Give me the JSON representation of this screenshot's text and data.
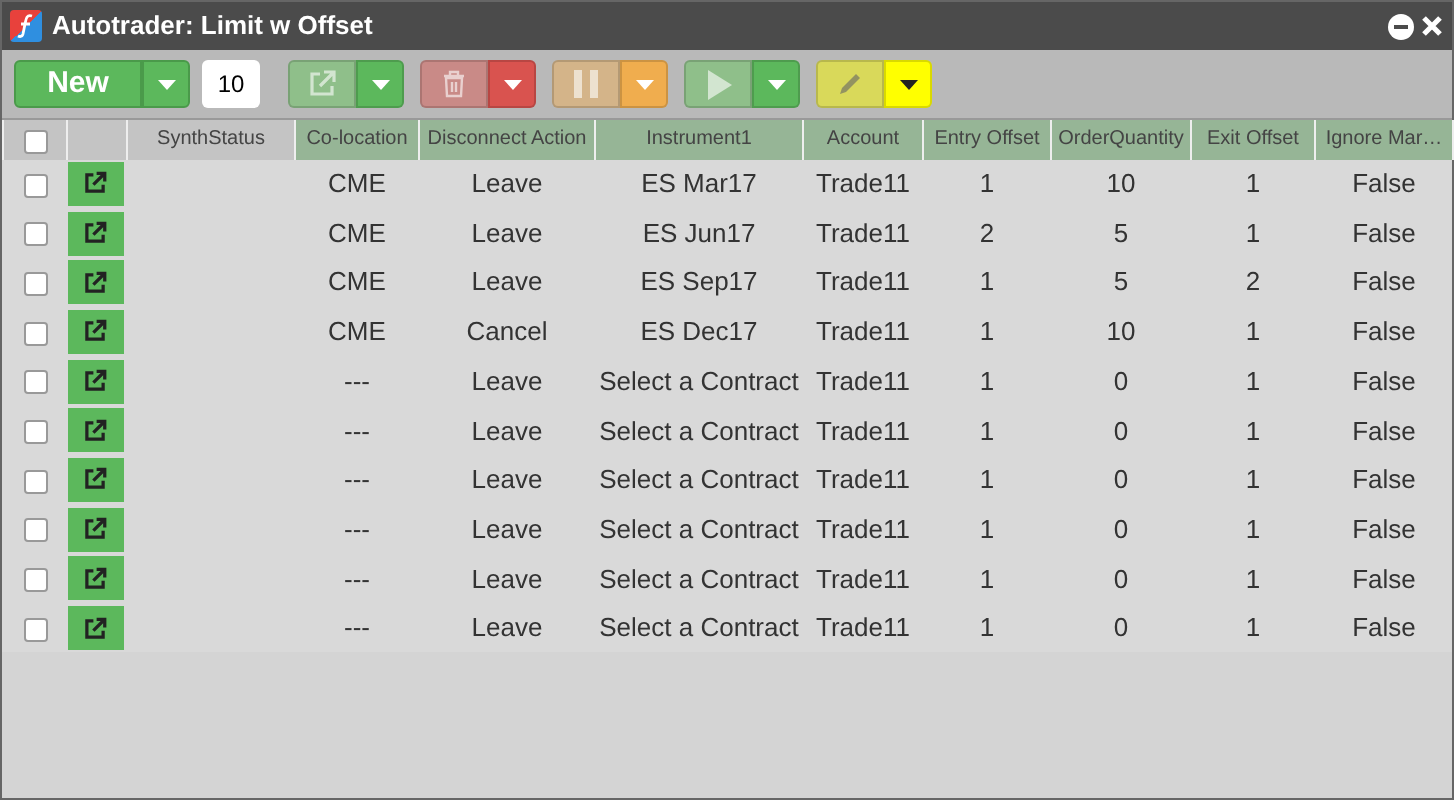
{
  "window": {
    "title": "Autotrader: Limit w Offset"
  },
  "toolbar": {
    "new_button": {
      "label": "New"
    },
    "quantity": "10",
    "tools": [
      {
        "kind": "launch",
        "disabled": true
      },
      {
        "kind": "delete",
        "disabled": true
      },
      {
        "kind": "pause",
        "disabled": true
      },
      {
        "kind": "play",
        "disabled": true
      },
      {
        "kind": "edit",
        "disabled": true
      }
    ]
  },
  "table": {
    "columns": [
      {
        "label": "SynthStatus",
        "highlighted": false
      },
      {
        "label": "Co-location",
        "highlighted": true
      },
      {
        "label": "Disconnect Action",
        "highlighted": true
      },
      {
        "label": "Instrument1",
        "highlighted": true
      },
      {
        "label": "Account",
        "highlighted": true
      },
      {
        "label": "Entry Offset",
        "highlighted": true
      },
      {
        "label": "OrderQuantity",
        "highlighted": true
      },
      {
        "label": "Exit Offset",
        "highlighted": true
      },
      {
        "label": "Ignore Mar…",
        "highlighted": true
      }
    ],
    "all_checked": false,
    "rows": [
      {
        "checked": false,
        "cells": [
          "",
          "CME",
          "Leave",
          "ES Mar17",
          "Trade11",
          "1",
          "10",
          "1",
          "False"
        ]
      },
      {
        "checked": false,
        "cells": [
          "",
          "CME",
          "Leave",
          "ES Jun17",
          "Trade11",
          "2",
          "5",
          "1",
          "False"
        ]
      },
      {
        "checked": false,
        "cells": [
          "",
          "CME",
          "Leave",
          "ES Sep17",
          "Trade11",
          "1",
          "5",
          "2",
          "False"
        ]
      },
      {
        "checked": false,
        "cells": [
          "",
          "CME",
          "Cancel",
          "ES Dec17",
          "Trade11",
          "1",
          "10",
          "1",
          "False"
        ]
      },
      {
        "checked": false,
        "cells": [
          "",
          "---",
          "Leave",
          "Select a Contract",
          "Trade11",
          "1",
          "0",
          "1",
          "False"
        ]
      },
      {
        "checked": false,
        "cells": [
          "",
          "---",
          "Leave",
          "Select a Contract",
          "Trade11",
          "1",
          "0",
          "1",
          "False"
        ]
      },
      {
        "checked": false,
        "cells": [
          "",
          "---",
          "Leave",
          "Select a Contract",
          "Trade11",
          "1",
          "0",
          "1",
          "False"
        ]
      },
      {
        "checked": false,
        "cells": [
          "",
          "---",
          "Leave",
          "Select a Contract",
          "Trade11",
          "1",
          "0",
          "1",
          "False"
        ]
      },
      {
        "checked": false,
        "cells": [
          "",
          "---",
          "Leave",
          "Select a Contract",
          "Trade11",
          "1",
          "0",
          "1",
          "False"
        ]
      },
      {
        "checked": false,
        "cells": [
          "",
          "---",
          "Leave",
          "Select a Contract",
          "Trade11",
          "1",
          "0",
          "1",
          "False"
        ]
      }
    ]
  }
}
